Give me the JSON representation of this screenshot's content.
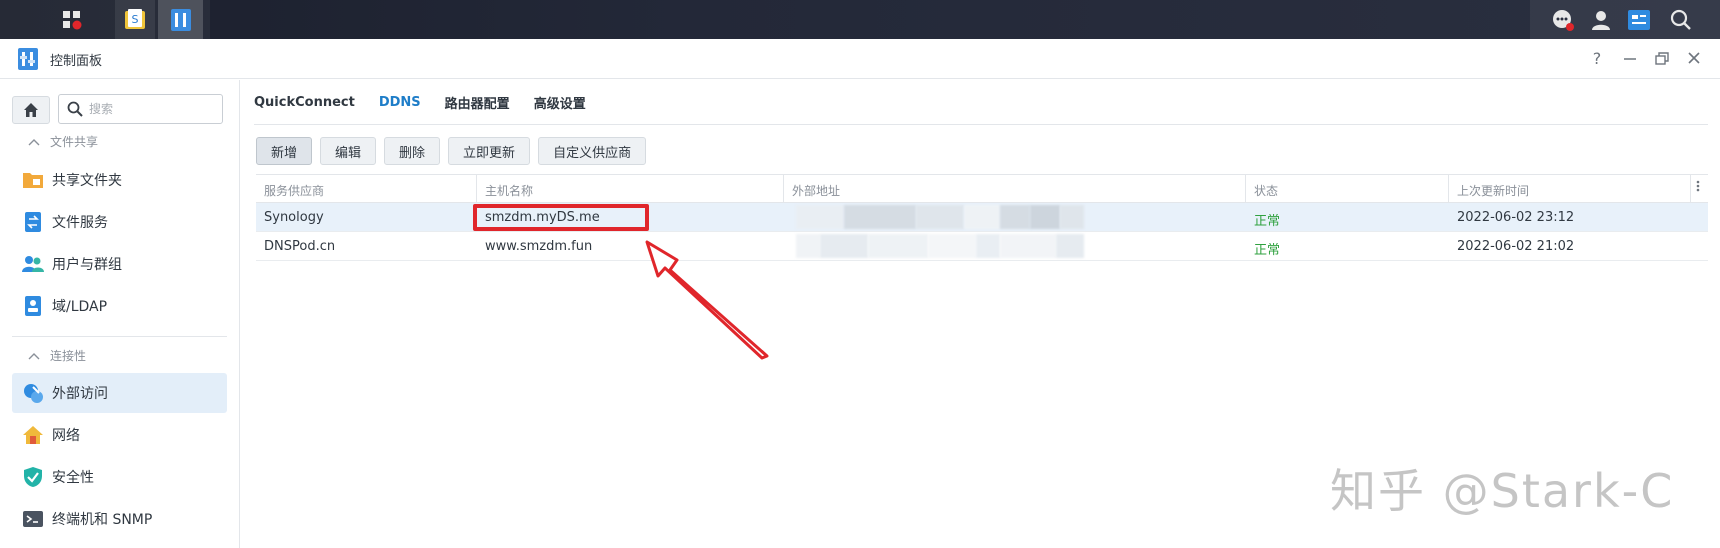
{
  "window": {
    "title": "控制面板"
  },
  "sidebar": {
    "search_placeholder": "搜索",
    "section_file_sharing": "文件共享",
    "section_connectivity": "连接性",
    "items": [
      {
        "label": "共享文件夹",
        "icon": "shared-folder-icon"
      },
      {
        "label": "文件服务",
        "icon": "file-services-icon"
      },
      {
        "label": "用户与群组",
        "icon": "users-groups-icon"
      },
      {
        "label": "域/LDAP",
        "icon": "domain-ldap-icon"
      },
      {
        "label": "外部访问",
        "icon": "external-access-icon",
        "active": true
      },
      {
        "label": "网络",
        "icon": "network-icon"
      },
      {
        "label": "安全性",
        "icon": "security-icon"
      },
      {
        "label": "终端机和 SNMP",
        "icon": "terminal-snmp-icon"
      }
    ]
  },
  "tabs": [
    {
      "label": "QuickConnect"
    },
    {
      "label": "DDNS",
      "active": true
    },
    {
      "label": "路由器配置"
    },
    {
      "label": "高级设置"
    }
  ],
  "toolbar": {
    "add": "新增",
    "edit": "编辑",
    "delete": "删除",
    "update_now": "立即更新",
    "custom_provider": "自定义供应商"
  },
  "table": {
    "columns": [
      "服务供应商",
      "主机名称",
      "外部地址",
      "状态",
      "上次更新时间"
    ],
    "rows": [
      {
        "provider": "Synology",
        "hostname": "smzdm.myDS.me",
        "status": "正常",
        "updated": "2022-06-02 23:12"
      },
      {
        "provider": "DNSPod.cn",
        "hostname": "www.smzdm.fun",
        "status": "正常",
        "updated": "2022-06-02 21:02"
      }
    ]
  },
  "watermark": "知乎 @Stark-C",
  "colors": {
    "accent": "#1e7dc8",
    "status_ok": "#2fa13f",
    "annotation": "#e0262b"
  }
}
